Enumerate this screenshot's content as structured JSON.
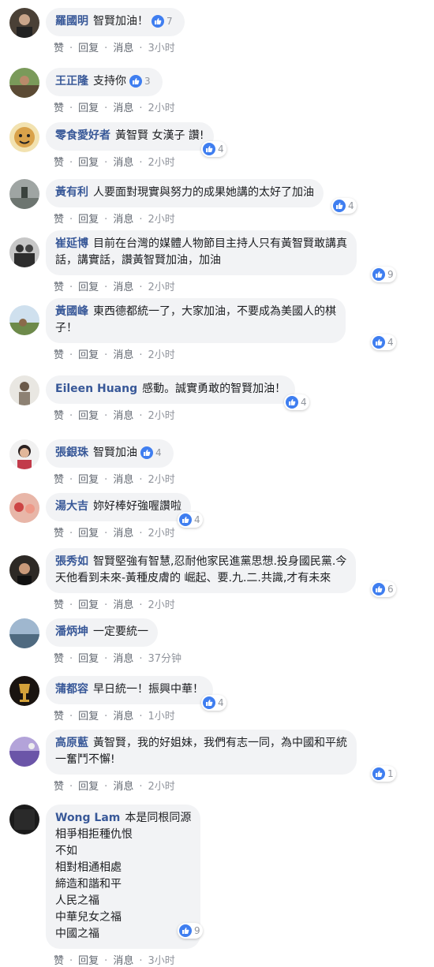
{
  "actions": {
    "like": "赞",
    "reply": "回复",
    "message": "消息"
  },
  "colors": {
    "name": "#385898",
    "bubble": "#f2f3f5",
    "like_blue": "#3f7ef0"
  },
  "comments": [
    {
      "name": "羅國明",
      "text": "智賢加油！",
      "reactions": "7",
      "time": "3小时",
      "avatar": "avatar-dark"
    },
    {
      "name": "王正隆",
      "text": "支持你",
      "reactions": "3",
      "time": "2小时",
      "avatar": "avatar-outdoor"
    },
    {
      "name": "零食愛好者",
      "text": "黃智賢 女漢子 讚!",
      "reactions": "4",
      "time": "2小时",
      "avatar": "avatar-cartoon"
    },
    {
      "name": "黃有利",
      "text": "人要面對現實與努力的成果她講的太好了加油",
      "reactions": "4",
      "time": "2小时",
      "avatar": "avatar-grey"
    },
    {
      "name": "崔延博",
      "text": "目前在台灣的媒體人物節目主持人只有黃智賢敢講真\n話，講實話，讚黃智賢加油，加油",
      "reactions": "9",
      "time": "2小时",
      "avatar": "avatar-people"
    },
    {
      "name": "黃國峰",
      "text": "東西德都統一了，大家加油，不要成為美國人的棋\n子！",
      "reactions": "4",
      "time": "2小时",
      "avatar": "avatar-landscape"
    },
    {
      "name": "Eileen Huang",
      "text": "感動。誠實勇敢的智賢加油！",
      "reactions": "4",
      "time": "2小时",
      "avatar": "avatar-person"
    },
    {
      "name": "張銀珠",
      "text": "智賢加油",
      "reactions": "4",
      "time": "2小时",
      "avatar": "avatar-woman"
    },
    {
      "name": "湯大吉",
      "text": "妳好棒好強喔讚啦",
      "reactions": "4",
      "time": "2小时",
      "avatar": "avatar-red"
    },
    {
      "name": "張秀如",
      "text": "智賢堅強有智慧,忍耐他家民進黨思想.投身國民黨.今\n天他看到未來-黃種皮膚的 崛起、要.九.二.共識,才有未來",
      "reactions": "6",
      "time": "2小时",
      "avatar": "avatar-woman2"
    },
    {
      "name": "潘炳坤",
      "text": "一定要統一",
      "reactions": "",
      "time": "37分钟",
      "avatar": "avatar-sky"
    },
    {
      "name": "蒲都容",
      "text": "早日統一！振興中華！",
      "reactions": "4",
      "time": "1小时",
      "avatar": "avatar-gold"
    },
    {
      "name": "高原藍",
      "text": "黃智賢，我的好姐妹，我們有志一同，為中國和平統\n一奮鬥不懈!",
      "reactions": "1",
      "time": "2小时",
      "avatar": "avatar-purple"
    },
    {
      "name": "Wong Lam",
      "text": "本是同根同源\n相爭相拒種仇恨\n不如\n相對相通相處\n締造和諧和平\n人民之福\n中華兒女之福\n中國之福",
      "reactions": "9",
      "time": "3小时",
      "avatar": "avatar-black"
    }
  ]
}
